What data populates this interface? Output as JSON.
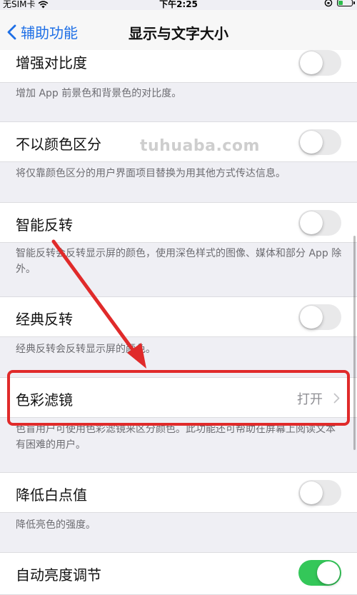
{
  "status": {
    "carrier": "无SIM卡",
    "time": "下午2:25",
    "battery_level": 0.35
  },
  "nav": {
    "back_label": "辅助功能",
    "title": "显示与文字大小"
  },
  "rows": [
    {
      "label": "增强对比度",
      "toggle": "off",
      "footer": "增加 App 前景色和背景色的对比度。"
    },
    {
      "label": "不以颜色区分",
      "toggle": "off",
      "footer": "将仅靠颜色区分的用户界面项目替换为用其他方式传达信息。"
    },
    {
      "label": "智能反转",
      "toggle": "off",
      "footer": "智能反转会反转显示屏的颜色，使用深色样式的图像、媒体和部分 App 除外。"
    },
    {
      "label": "经典反转",
      "toggle": "off",
      "footer": "经典反转会反转显示屏的颜色。"
    },
    {
      "label": "色彩滤镜",
      "value": "打开",
      "footer": "色盲用户可使用色彩滤镜来区分颜色。此功能还可帮助在屏幕上阅读文本有困难的用户。"
    },
    {
      "label": "降低白点值",
      "toggle": "off",
      "footer": "降低亮色的强度。"
    },
    {
      "label": "自动亮度调节",
      "toggle": "on"
    }
  ],
  "watermark": "tuhuaba.com",
  "colors": {
    "accent": "#1e6fe6",
    "toggle_on": "#34c759",
    "annotation": "#e02a2a"
  },
  "icons": {
    "back": "chevron-left-icon",
    "disclosure": "chevron-right-icon",
    "wifi": "wifi-icon",
    "battery": "battery-charging-icon",
    "lock": "rotation-lock-icon"
  }
}
